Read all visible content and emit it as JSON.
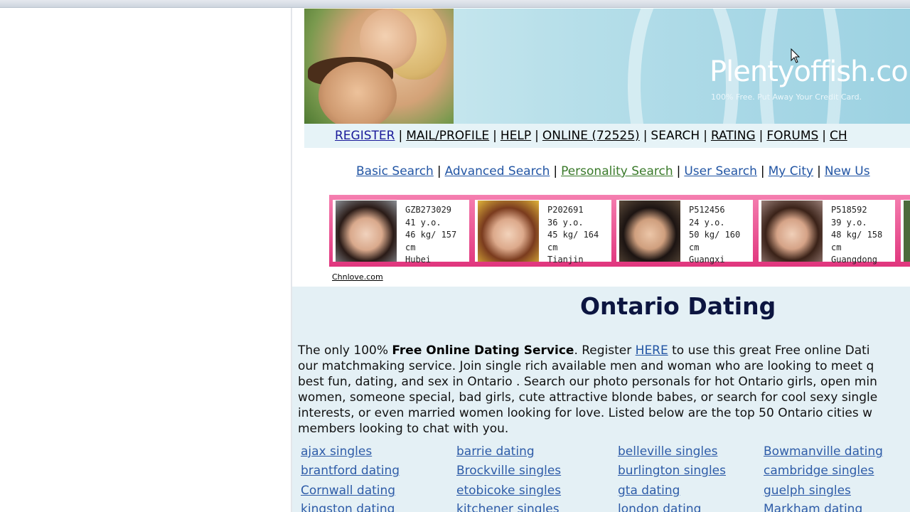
{
  "banner": {
    "logo": "Plentyoffish.co",
    "tagline": "100% Free. Put Away Your Credit Card."
  },
  "mainnav": {
    "items": [
      {
        "label": "REGISTER"
      },
      {
        "label": "MAIL/PROFILE"
      },
      {
        "label": "HELP"
      },
      {
        "label": "ONLINE (72525)"
      },
      {
        "label": "SEARCH"
      },
      {
        "label": "RATING"
      },
      {
        "label": "FORUMS"
      },
      {
        "label": "CH"
      }
    ]
  },
  "subnav": {
    "items": [
      {
        "label": "Basic Search"
      },
      {
        "label": "Advanced Search"
      },
      {
        "label": "Personality Search"
      },
      {
        "label": "User Search"
      },
      {
        "label": "My City"
      },
      {
        "label": "New Us"
      }
    ]
  },
  "ads": {
    "source": "Chnlove.com",
    "profiles": [
      {
        "id": "GZB273029",
        "age": "41 y.o.",
        "stats": "46 kg/ 157 cm",
        "place": "Hubei"
      },
      {
        "id": "P202691",
        "age": "36 y.o.",
        "stats": "45 kg/ 164 cm",
        "place": "Tianjin"
      },
      {
        "id": "P512456",
        "age": "24 y.o.",
        "stats": "50 kg/ 160 cm",
        "place": "Guangxi"
      },
      {
        "id": "P518592",
        "age": "39 y.o.",
        "stats": "48 kg/ 158 cm",
        "place": "Guangdong"
      }
    ]
  },
  "content": {
    "title": "Ontario Dating",
    "p1": "The only 100% ",
    "p1_bold": "Free Online Dating Service",
    "p1_after": ". Register ",
    "p1_link": "HERE",
    "p1_rest": " to use this great Free online Dati",
    "lines": [
      "our matchmaking service. Join single rich available men and woman who are looking to meet q",
      "best fun, dating, and sex in Ontario . Search our photo personals for hot Ontario girls, open min",
      "women, someone special, bad girls, cute attractive blonde babes, or search for cool sexy single",
      "interests, or even married women looking for love. Listed below are the top 50 Ontario cities w",
      "members looking to chat with you."
    ],
    "cities": [
      "ajax singles",
      "barrie dating",
      "belleville singles",
      "Bowmanville dating",
      "brantford dating",
      "Brockville singles",
      "burlington singles",
      "cambridge singles",
      "Cornwall dating",
      "etobicoke singles",
      "gta dating",
      "guelph singles",
      "kingston dating",
      "kitchener singles",
      "london dating",
      "Markham dating"
    ]
  }
}
